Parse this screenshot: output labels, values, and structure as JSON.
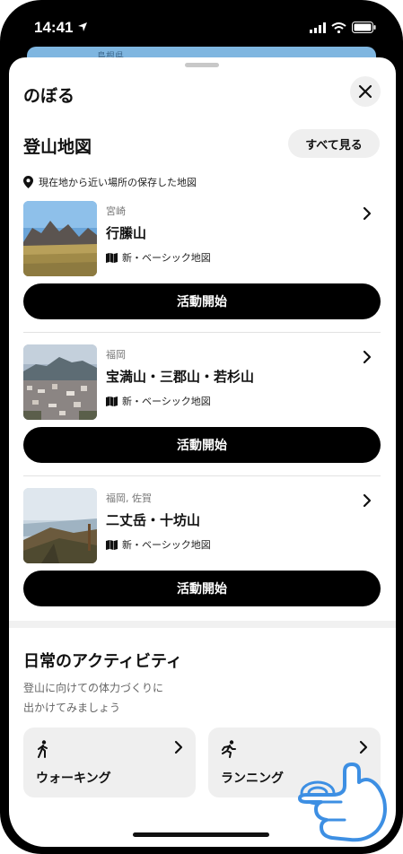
{
  "status_bar": {
    "time": "14:41"
  },
  "background_map": {
    "region_label": "島根県"
  },
  "sheet": {
    "title": "のぼる",
    "maps_section": {
      "title": "登山地図",
      "see_all": "すべて見る",
      "nearby_note": "現在地から近い場所の保存した地図",
      "items": [
        {
          "prefecture": "宮崎",
          "name": "行縢山",
          "map_type": "新・ベーシック地図",
          "start": "活動開始"
        },
        {
          "prefecture": "福岡",
          "name": "宝満山・三郡山・若杉山",
          "map_type": "新・ベーシック地図",
          "start": "活動開始"
        },
        {
          "prefecture": "福岡, 佐賀",
          "name": "二丈岳・十坊山",
          "map_type": "新・ベーシック地図",
          "start": "活動開始"
        }
      ]
    },
    "daily_section": {
      "title": "日常のアクティビティ",
      "subtitle_line1": "登山に向けての体力づくりに",
      "subtitle_line2": "出かけてみましょう",
      "activities": [
        {
          "label": "ウォーキング",
          "icon": "walking-icon"
        },
        {
          "label": "ランニング",
          "icon": "running-icon"
        }
      ]
    }
  },
  "colors": {
    "primary_button": "#000000",
    "chip_bg": "#efefef",
    "accent_hand": "#3d8fe3"
  }
}
